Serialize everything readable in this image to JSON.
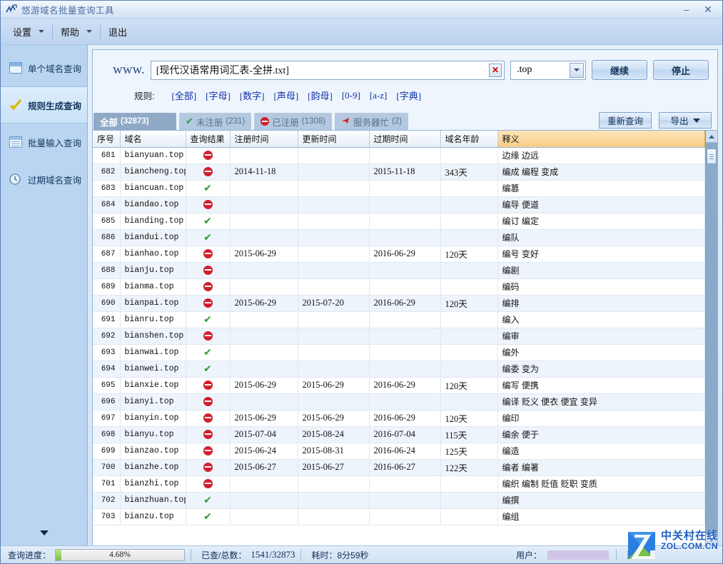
{
  "window": {
    "title": "悠游域名批量查询工具",
    "minimize_label": "–",
    "close_label": "✕"
  },
  "menubar": {
    "items": [
      {
        "label": "设置",
        "has_dropdown": true
      },
      {
        "label": "帮助",
        "has_dropdown": true
      },
      {
        "label": "退出",
        "has_dropdown": false
      }
    ]
  },
  "sidebar": {
    "items": [
      {
        "label": "单个域名查询",
        "icon": "window-icon",
        "active": false
      },
      {
        "label": "规则生成查询",
        "icon": "check-mark-icon",
        "active": true
      },
      {
        "label": "批量输入查询",
        "icon": "list-icon",
        "active": false
      },
      {
        "label": "过期域名查询",
        "icon": "clock-icon",
        "active": false
      }
    ],
    "collapse_icon": "chevron-down-icon"
  },
  "search": {
    "prefix": "www.",
    "path_value": "[现代汉语常用词汇表-全拼.txt]",
    "path_placeholder": "",
    "clear_icon": "close-icon",
    "tld_value": ".top",
    "tld_arrow_icon": "chevron-down-icon",
    "continue_label": "继续",
    "stop_label": "停止"
  },
  "rules": {
    "label": "规则:",
    "links": [
      "[全部]",
      "[字母]",
      "[数字]",
      "[声母]",
      "[韵母]",
      "[0-9]",
      "[a-z]",
      "[字典]"
    ]
  },
  "tabs": [
    {
      "label": "全部",
      "count": "(32873)",
      "icon": "none",
      "active": true
    },
    {
      "label": "未注册",
      "count": "(231)",
      "icon": "check-mark-icon",
      "active": false
    },
    {
      "label": "已注册",
      "count": "(1308)",
      "icon": "no-entry-icon",
      "active": false
    },
    {
      "label": "服务器忙",
      "count": "(2)",
      "icon": "busy-icon",
      "active": false
    }
  ],
  "tab_actions": {
    "requery_label": "重新查询",
    "export_label": "导出",
    "export_arrow_icon": "triangle-down-icon"
  },
  "table": {
    "columns": [
      {
        "key": "no",
        "label": "序号",
        "highlight": false
      },
      {
        "key": "domain",
        "label": "域名",
        "highlight": false
      },
      {
        "key": "result",
        "label": "查询结果",
        "highlight": false
      },
      {
        "key": "reg",
        "label": "注册时间",
        "highlight": false
      },
      {
        "key": "upd",
        "label": "更新时间",
        "highlight": false
      },
      {
        "key": "exp",
        "label": "过期时间",
        "highlight": false
      },
      {
        "key": "age",
        "label": "域名年龄",
        "highlight": false
      },
      {
        "key": "meaning",
        "label": "释义",
        "highlight": true
      }
    ],
    "rows": [
      {
        "no": "681",
        "domain": "bianyuan.top",
        "result": "registered",
        "reg": "",
        "upd": "",
        "exp": "",
        "age": "",
        "meaning": "边缘 边远"
      },
      {
        "no": "682",
        "domain": "biancheng.top",
        "result": "registered",
        "reg": "2014-11-18",
        "upd": "",
        "exp": "2015-11-18",
        "age": "343天",
        "meaning": "编成 编程 变成"
      },
      {
        "no": "683",
        "domain": "biancuan.top",
        "result": "available",
        "reg": "",
        "upd": "",
        "exp": "",
        "age": "",
        "meaning": "编篡"
      },
      {
        "no": "684",
        "domain": "biandao.top",
        "result": "registered",
        "reg": "",
        "upd": "",
        "exp": "",
        "age": "",
        "meaning": "编导 便道"
      },
      {
        "no": "685",
        "domain": "bianding.top",
        "result": "available",
        "reg": "",
        "upd": "",
        "exp": "",
        "age": "",
        "meaning": "编订 编定"
      },
      {
        "no": "686",
        "domain": "biandui.top",
        "result": "available",
        "reg": "",
        "upd": "",
        "exp": "",
        "age": "",
        "meaning": "编队"
      },
      {
        "no": "687",
        "domain": "bianhao.top",
        "result": "registered",
        "reg": "2015-06-29",
        "upd": "",
        "exp": "2016-06-29",
        "age": "120天",
        "meaning": "编号 变好"
      },
      {
        "no": "688",
        "domain": "bianju.top",
        "result": "registered",
        "reg": "",
        "upd": "",
        "exp": "",
        "age": "",
        "meaning": "编剧"
      },
      {
        "no": "689",
        "domain": "bianma.top",
        "result": "registered",
        "reg": "",
        "upd": "",
        "exp": "",
        "age": "",
        "meaning": "编码"
      },
      {
        "no": "690",
        "domain": "bianpai.top",
        "result": "registered",
        "reg": "2015-06-29",
        "upd": "2015-07-20",
        "exp": "2016-06-29",
        "age": "120天",
        "meaning": "编排"
      },
      {
        "no": "691",
        "domain": "bianru.top",
        "result": "available",
        "reg": "",
        "upd": "",
        "exp": "",
        "age": "",
        "meaning": "编入"
      },
      {
        "no": "692",
        "domain": "bianshen.top",
        "result": "registered",
        "reg": "",
        "upd": "",
        "exp": "",
        "age": "",
        "meaning": "编审"
      },
      {
        "no": "693",
        "domain": "bianwai.top",
        "result": "available",
        "reg": "",
        "upd": "",
        "exp": "",
        "age": "",
        "meaning": "编外"
      },
      {
        "no": "694",
        "domain": "bianwei.top",
        "result": "available",
        "reg": "",
        "upd": "",
        "exp": "",
        "age": "",
        "meaning": "编委 变为"
      },
      {
        "no": "695",
        "domain": "bianxie.top",
        "result": "registered",
        "reg": "2015-06-29",
        "upd": "2015-06-29",
        "exp": "2016-06-29",
        "age": "120天",
        "meaning": "编写 便携"
      },
      {
        "no": "696",
        "domain": "bianyi.top",
        "result": "registered",
        "reg": "",
        "upd": "",
        "exp": "",
        "age": "",
        "meaning": "编译 贬义 便衣 便宜 变异"
      },
      {
        "no": "697",
        "domain": "bianyin.top",
        "result": "registered",
        "reg": "2015-06-29",
        "upd": "2015-06-29",
        "exp": "2016-06-29",
        "age": "120天",
        "meaning": "编印"
      },
      {
        "no": "698",
        "domain": "bianyu.top",
        "result": "registered",
        "reg": "2015-07-04",
        "upd": "2015-08-24",
        "exp": "2016-07-04",
        "age": "115天",
        "meaning": "编余 便于"
      },
      {
        "no": "699",
        "domain": "bianzao.top",
        "result": "registered",
        "reg": "2015-06-24",
        "upd": "2015-08-31",
        "exp": "2016-06-24",
        "age": "125天",
        "meaning": "编造"
      },
      {
        "no": "700",
        "domain": "bianzhe.top",
        "result": "registered",
        "reg": "2015-06-27",
        "upd": "2015-06-27",
        "exp": "2016-06-27",
        "age": "122天",
        "meaning": "编者 编著"
      },
      {
        "no": "701",
        "domain": "bianzhi.top",
        "result": "registered",
        "reg": "",
        "upd": "",
        "exp": "",
        "age": "",
        "meaning": "编织 编制 贬值 贬职 变质"
      },
      {
        "no": "702",
        "domain": "bianzhuan.top",
        "result": "available",
        "reg": "",
        "upd": "",
        "exp": "",
        "age": "",
        "meaning": "编撰"
      },
      {
        "no": "703",
        "domain": "bianzu.top",
        "result": "available",
        "reg": "",
        "upd": "",
        "exp": "",
        "age": "",
        "meaning": "编组"
      }
    ]
  },
  "scrollbar": {
    "up_icon": "arrow-up-icon",
    "down_icon": "arrow-down-icon"
  },
  "statusbar": {
    "progress_label": "查询进度：",
    "progress_percent": "4.68%",
    "counted_label": "已查/总数：",
    "counted_value": "1541/32873",
    "elapsed_label": "耗时：8分59秒",
    "user_label": "用户：",
    "user_value": "",
    "expiry_label": "到期"
  },
  "watermark": {
    "cn": "中关村在线",
    "en": "ZOL.COM.CN",
    "logo_icon": "zol-logo-icon"
  }
}
